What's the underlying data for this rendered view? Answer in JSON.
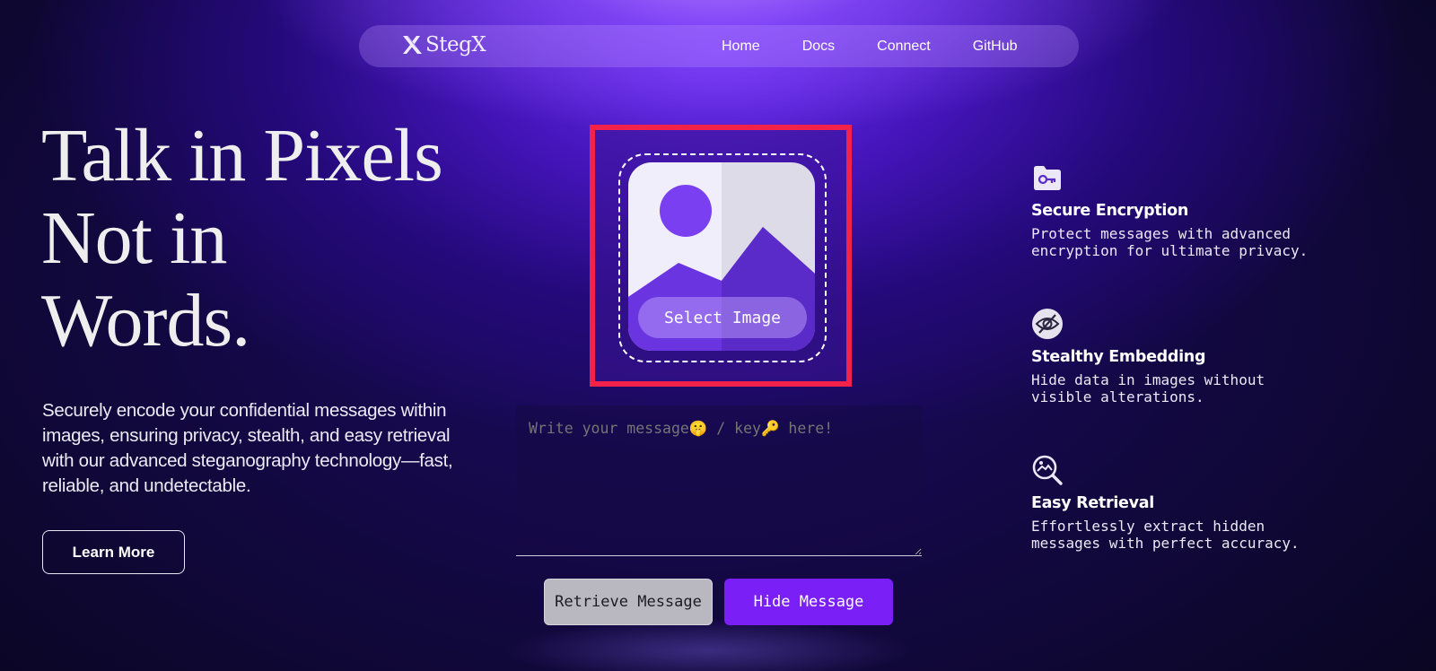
{
  "nav": {
    "brand": "StegX",
    "links": [
      "Home",
      "Docs",
      "Connect",
      "GitHub"
    ]
  },
  "hero": {
    "title_lines": [
      "Talk in Pixels",
      "Not in",
      "Words."
    ],
    "description": "Securely encode your confidential messages within images, ensuring privacy, stealth, and easy retrieval with our advanced steganography technology—fast, reliable, and undetectable.",
    "learn_more_label": "Learn More"
  },
  "uploader": {
    "select_label": "Select Image",
    "message_placeholder": "Write your message🤫 / key🔑 here!",
    "retrieve_label": "Retrieve Message",
    "hide_label": "Hide Message"
  },
  "features": [
    {
      "icon": "folder-key-icon",
      "title": "Secure Encryption",
      "description": "Protect messages with advanced encryption for ultimate privacy."
    },
    {
      "icon": "eye-slash-icon",
      "title": "Stealthy Embedding",
      "description": "Hide data in images without visible alterations."
    },
    {
      "icon": "image-search-icon",
      "title": "Easy Retrieval",
      "description": "Effortlessly extract hidden messages with perfect accuracy."
    }
  ],
  "colors": {
    "accent": "#7a1ff6",
    "highlight_border": "#f2224a",
    "retrieve_button": "#b9b7bf"
  }
}
